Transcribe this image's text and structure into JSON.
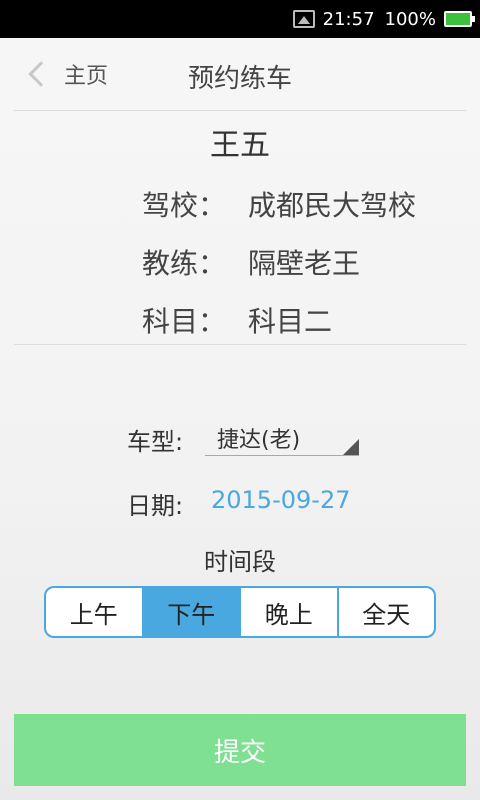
{
  "status_bar": {
    "time": "21:57",
    "battery": "100%",
    "icons": [
      "image-notification-icon",
      "battery-icon"
    ]
  },
  "header": {
    "back_label": "主页",
    "title": "预约练车"
  },
  "student": {
    "name": "王五",
    "rows": [
      {
        "key": "驾校：",
        "value": "成都民大驾校"
      },
      {
        "key": "教练：",
        "value": "隔壁老王"
      },
      {
        "key": "科目：",
        "value": "科目二"
      }
    ]
  },
  "form": {
    "car_type_label": "车型:",
    "car_type_value": "捷达(老)",
    "date_label": "日期:",
    "date_value": "2015-09-27",
    "period_title": "时间段",
    "periods": [
      "上午",
      "下午",
      "晚上",
      "全天"
    ],
    "selected_period": "下午"
  },
  "submit_label": "提交",
  "colors": {
    "accent": "#4aa8e0",
    "submit": "#7fe091"
  }
}
